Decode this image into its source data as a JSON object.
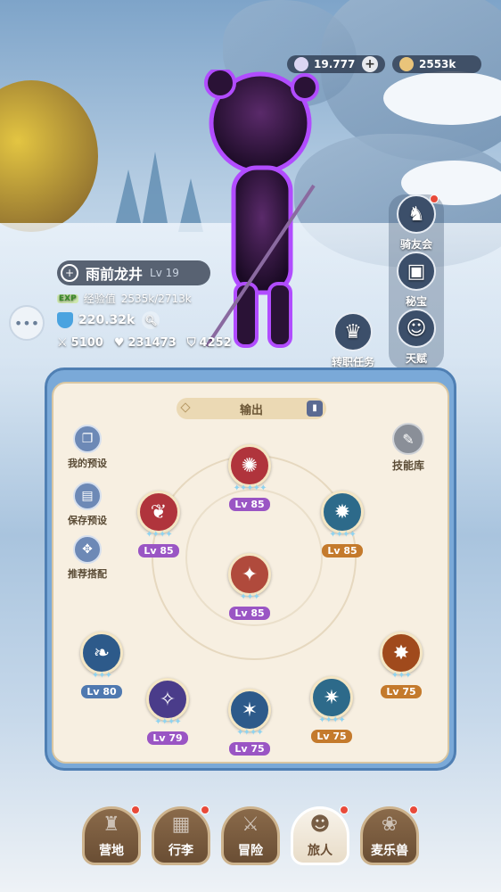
{
  "currency": {
    "stars_value": "19.777",
    "coins_value": "2553k"
  },
  "side_menu": {
    "club_label": "骑友会",
    "treasure_label": "秘宝",
    "talent_label": "天赋",
    "job_quest_label": "转职任务"
  },
  "player": {
    "name": "雨前龙井",
    "level": "Lv 19",
    "exp_badge": "EXP",
    "exp_label": "经验值",
    "exp_value": "2535k/2713k",
    "power": "220.32k",
    "attack": "5100",
    "hp": "231473",
    "defense": "4252"
  },
  "skills_panel": {
    "tab_label": "输出",
    "my_preset_label": "我的预设",
    "save_preset_label": "保存预设",
    "recommend_label": "推荐搭配",
    "skill_library_label": "技能库",
    "skills": [
      {
        "level": "Lv 85",
        "stars": "✦✦✦✦✦",
        "color": "#b0343c"
      },
      {
        "level": "Lv 85",
        "stars": "✦✦✦✦",
        "color": "#b0343c"
      },
      {
        "level": "Lv 85",
        "stars": "✦✦✦✦",
        "color": "#2d6a8a"
      },
      {
        "level": "Lv 85",
        "stars": "✦✦✦",
        "color": "#b04a3c"
      },
      {
        "level": "Lv 80",
        "stars": "✦✦✦",
        "color": "#2d5a8a"
      },
      {
        "level": "Lv 75",
        "stars": "✦✦✦",
        "color": "#a04a1c"
      },
      {
        "level": "Lv 79",
        "stars": "✦✦✦✦",
        "color": "#4a3c8a"
      },
      {
        "level": "Lv 75",
        "stars": "✦✦✦✦",
        "color": "#2d5a8a"
      },
      {
        "level": "Lv 75",
        "stars": "✦✦✦✦",
        "color": "#2d6a8a"
      }
    ]
  },
  "bottom_nav": {
    "camp": "营地",
    "bag": "行李",
    "adventure": "冒险",
    "traveler": "旅人",
    "pet": "麦乐兽"
  }
}
